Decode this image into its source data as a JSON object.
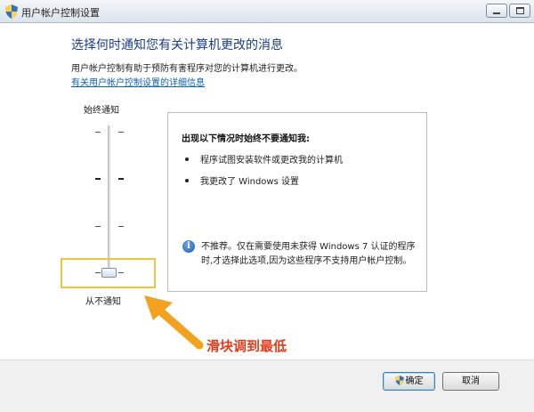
{
  "window": {
    "title": "用户帐户控制设置"
  },
  "main": {
    "heading": "选择何时通知您有关计算机更改的消息",
    "description": "用户帐户控制有助于预防有害程序对您的计算机进行更改。",
    "link": "有关用户帐户控制设置的详细信息"
  },
  "slider": {
    "top_label": "始终通知",
    "bottom_label": "从不通知",
    "level": 0
  },
  "panel": {
    "title": "出现以下情况时始终不要通知我:",
    "bullets": [
      "程序试图安装软件或更改我的计算机",
      "我更改了 Windows 设置"
    ],
    "note": "不推荐。仅在需要使用未获得 Windows 7 认证的程序时,才选择此选项,因为这些程序不支持用户帐户控制。"
  },
  "annotation": {
    "text": "滑块调到最低",
    "color": "#e23b1b"
  },
  "buttons": {
    "ok": "确定",
    "cancel": "取消"
  },
  "icons": {
    "title_icon": "uac-shield-icon",
    "minimize": "minimize-icon",
    "maximize": "maximize-icon",
    "info": "info-icon",
    "ok_shield": "uac-shield-icon"
  }
}
